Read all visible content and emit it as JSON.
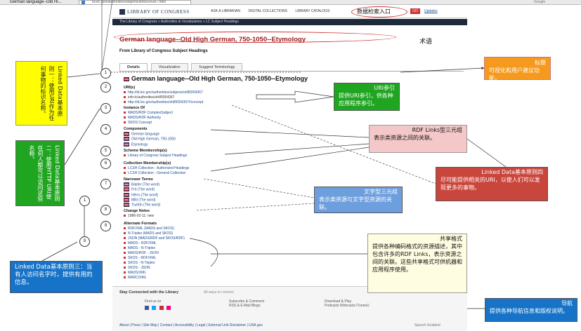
{
  "browser": {
    "tab_title": "German language--Old Hi...",
    "url": "id.loc.gov/authorities/subjects/sh85054367.html",
    "search_provider": "Google"
  },
  "loc": {
    "logo_text": "LIBRARY OF CONGRESS",
    "nav": [
      "ASK A LIBRARIAN",
      "DIGITAL COLLECTIONS",
      "LIBRARY CATALOGS"
    ],
    "search_entry": "数据检索入口",
    "go": "GO",
    "updates": "Updates",
    "breadcrumbs": "The Library of Congress  »  Authorities & Vocabularies  »  LC Subject Headings",
    "page_title": "German language--Old High German, 750-1050--Etymology",
    "title_note": "术语",
    "source_line": "From Library of Congress Subject Headings",
    "tabs": [
      "Details",
      "Visualization",
      "Suggest Terminology"
    ],
    "heading": "German language--Old High German, 750-1050--Etymology",
    "uri_section": {
      "title": "URI(s)",
      "items": [
        "http://id.loc.gov/authorities/subjects/sh85054367",
        "info:lc/authorities/sh85054367",
        "http://id.loc.gov/authorities/sh85054367#concept"
      ]
    },
    "instance_section": {
      "title": "Instance Of",
      "items": [
        "MADS/RDF ComplexSubject",
        "MADS/RDF Authority",
        "SKOS Concept"
      ]
    },
    "components_section": {
      "title": "Components",
      "items": [
        "German language",
        "Old High German, 750-1050",
        "Etymology"
      ]
    },
    "scheme_section": {
      "title": "Scheme Membership(s)",
      "items": [
        "Library of Congress Subject Headings"
      ]
    },
    "collection_section": {
      "title": "Collection Membership(s)",
      "items": [
        "LCSH Collection - Authorized Headings",
        "LCSH Collection - General Collection"
      ]
    },
    "narrower_section": {
      "title": "Narrower Terms",
      "items": [
        "Balder (The word)",
        "Frô (The word)",
        "Hêrro (The word)",
        "Milti (The word)",
        "Truhtîn (The word)"
      ]
    },
    "change_section": {
      "title": "Change Notes",
      "items": [
        "1986-02-11: new"
      ]
    },
    "alt_section": {
      "title": "Alternate Formats",
      "items": [
        "RDF/XML (MADS and SKOS)",
        "N-Triples (MADS and SKOS)",
        "JSON (MADS/RDF and SKOS/RDF)",
        "MADS - RDF/XML",
        "MADS - N-Triples",
        "MADS/RDF - JSON",
        "SKOS - RDF/XML",
        "SKOS - N-Triples",
        "SKOS - JSON",
        "MADS/XML",
        "MARC/XML"
      ]
    },
    "footer": {
      "title": "Stay Connected with the Library",
      "subtitle": "All ways to connect",
      "find_us": "Find us on",
      "subscribe": "Subscribe & Comment",
      "subscribe_links": "RSS & E-Mail    Blogs",
      "download": "Download & Play",
      "download_links": "Podcasts    Webcasts    iTunesU",
      "links": "About | Press | Site Map | Contact | Accessibility | Legal | External Link Disclaimer | USA.gov",
      "speech": "Speech Enabled"
    }
  },
  "annotations": {
    "yellow": "Linked Data基本原则一：使用URI作为任何事物的标识名称。",
    "green_left": "Linked Data基本原则二：使用HTTP URI使任何人都可以访问这些名称。",
    "blue_left": "Linked Data基本原则三：当有人访问名字时，提供有用的信息。",
    "title_label": "标题",
    "title_body": "可视化和用户建议功能。",
    "uri_label": "URI参引",
    "uri_body": "提供URI参引，供各种应用程序参引。",
    "rdf_label": "RDF Links型三元组",
    "rdf_body": "表示类资源之间的关联。",
    "ld_label": "Linked Data基本原则四",
    "ld_body": "尽可能提供相关的URI，以使人们可以发现更多的事物。",
    "text_label": "文字型三元组",
    "text_body": "表示类资源与文字型资源的关联。",
    "shared_label": "共享格式",
    "shared_body": "提供各种编码格式的资源描述，其中包含许多的RDF Links，表示资源之间的关联。这些共享格式可供机器和应用程序使用。",
    "nav_label": "导航",
    "nav_body": "提供各种导航信息和版权说明。"
  },
  "markers": [
    "1",
    "2",
    "3",
    "4",
    "5",
    "6",
    "7",
    "8",
    "9",
    "9",
    "1"
  ]
}
